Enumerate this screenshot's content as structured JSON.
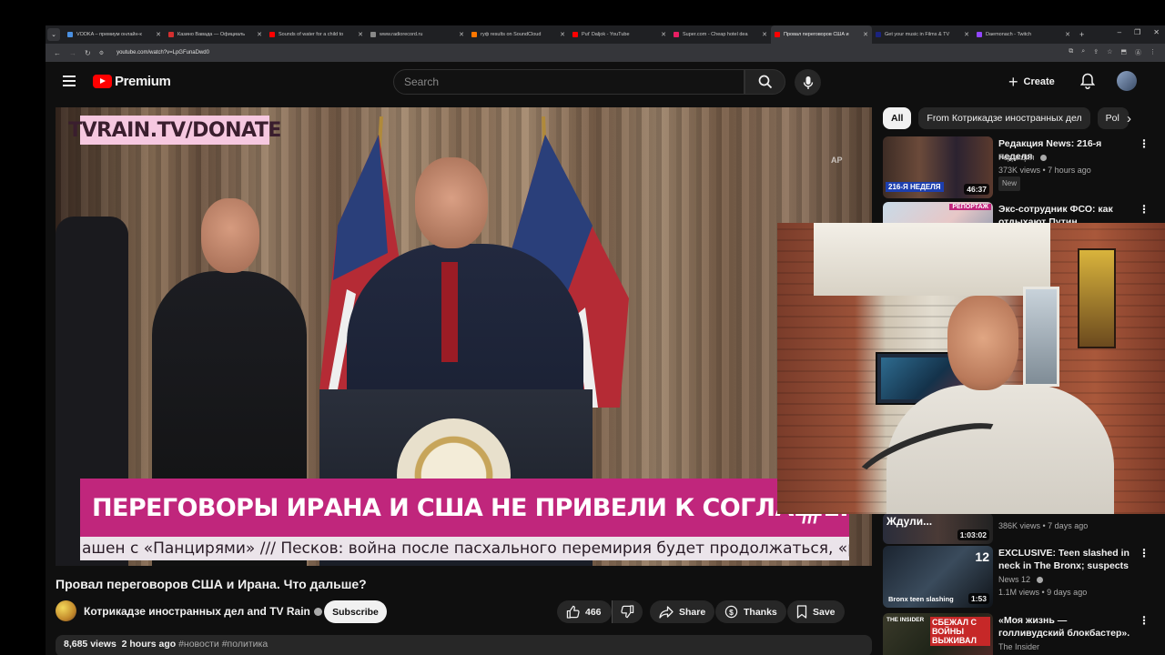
{
  "browser": {
    "tabs": [
      {
        "title": "VODKA – премиум онлайн-к",
        "color": "#4a90e2"
      },
      {
        "title": "Казино Вавада — Официаль",
        "color": "#d32f2f"
      },
      {
        "title": "Sounds of water for a child to",
        "color": "#ff0000"
      },
      {
        "title": "www.radiorecord.ru",
        "color": "#888888"
      },
      {
        "title": "гуф results on SoundCloud",
        "color": "#ff7700"
      },
      {
        "title": "Put' Daljok - YouTube",
        "color": "#ff0000"
      },
      {
        "title": "Super.com - Cheap hotel dea",
        "color": "#e91e63"
      },
      {
        "title": "Провал переговоров США и",
        "color": "#ff0000"
      },
      {
        "title": "Get your music in Films & TV",
        "color": "#1a237e"
      },
      {
        "title": "Daemonach - Twitch",
        "color": "#9146ff"
      }
    ],
    "active_tab_index": 7,
    "url": "youtube.com/watch?v=LpGFunaDwd0"
  },
  "youtube": {
    "logo_text": "Premium",
    "search_placeholder": "Search",
    "create_label": "Create",
    "video": {
      "donate_text": "TVRAIN.TV/DONATE",
      "watermark": "AP",
      "headline": "ПЕРЕГОВОРЫ ИРАНА И США НЕ ПРИВЕЛИ К СОГЛАШЕНИЮ",
      "ticker": "ашен с «Панцирями» /// Песков: война после пасхального перемирия будет продолжаться, «разно",
      "slashes": "///"
    },
    "title": "Провал переговоров США и Ирана. Что дальше?",
    "channel": {
      "name": "Котрикадзе иностранных дел and TV Rain",
      "subscribe_label": "Subscribe"
    },
    "actions": {
      "likes": "466",
      "share": "Share",
      "thanks": "Thanks",
      "save": "Save"
    },
    "description": {
      "views": "8,685 views",
      "age": "2 hours ago",
      "tags": "#новости #политика"
    },
    "chips": [
      "All",
      "From Котрикадзе иностранных дел",
      "Pol"
    ],
    "recommendations": [
      {
        "title": "Редакция News: 216-я неделя",
        "channel": "Редакция",
        "stats": "373K views • 7 hours ago",
        "badge": "New",
        "duration": "46:37",
        "thumb_text": "216-Я НЕДЕЛЯ"
      },
      {
        "title": "Экс-сотрудник ФСО: как отдыхают Путин, Медведев...",
        "thumb_text": "РЕПОРТАЖ"
      },
      {
        "title": "",
        "stats": "386K views • 7 days ago",
        "duration": "1:03:02",
        "thumb_text": "Ждули..."
      },
      {
        "title": "EXCLUSIVE: Teen slashed in neck in The Bronx; suspects st...",
        "channel": "News 12",
        "stats": "1.1M views • 9 days ago",
        "duration": "1:53",
        "thumb_text": "Bronx teen slashing",
        "corner": "12"
      },
      {
        "title": "«Моя жизнь — голливудский блокбастер». История казак...",
        "channel": "The Insider",
        "thumb_text": "СБЕЖАЛ С ВОЙНЫ ВЫЖИВАЛ",
        "corner": "THE INSIDER"
      }
    ]
  }
}
